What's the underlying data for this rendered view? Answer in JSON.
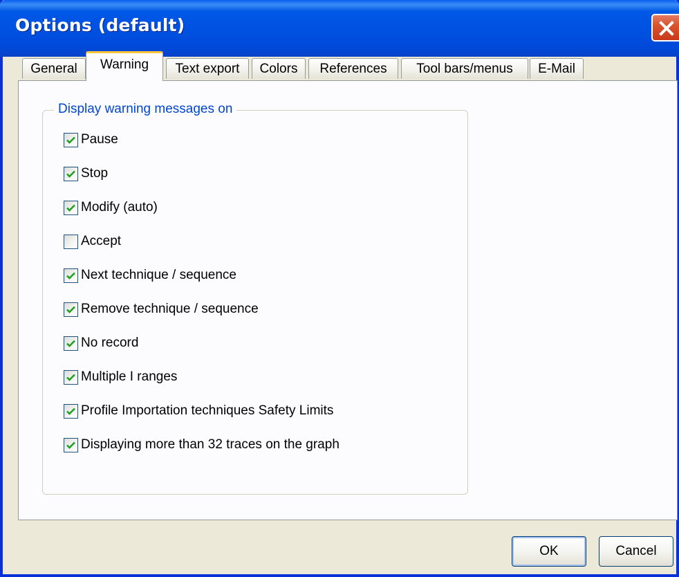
{
  "window": {
    "title": "Options (default)"
  },
  "tabs": [
    {
      "label": "General"
    },
    {
      "label": "Warning",
      "active": true
    },
    {
      "label": "Text export"
    },
    {
      "label": "Colors"
    },
    {
      "label": "References"
    },
    {
      "label": "Tool bars/menus"
    },
    {
      "label": "E-Mail"
    }
  ],
  "group": {
    "title": "Display warning messages on",
    "items": [
      {
        "label": "Pause",
        "checked": true
      },
      {
        "label": "Stop",
        "checked": true
      },
      {
        "label": "Modify (auto)",
        "checked": true
      },
      {
        "label": "Accept",
        "checked": false
      },
      {
        "label": "Next technique / sequence",
        "checked": true
      },
      {
        "label": "Remove technique / sequence",
        "checked": true
      },
      {
        "label": "No record",
        "checked": true
      },
      {
        "label": "Multiple I ranges",
        "checked": true
      },
      {
        "label": "Profile Importation techniques Safety Limits",
        "checked": true
      },
      {
        "label": "Displaying more than 32 traces on the graph",
        "checked": true
      }
    ]
  },
  "buttons": {
    "ok_label": "OK",
    "cancel_label": "Cancel"
  },
  "colors": {
    "titlebar": "#0054E3",
    "accent_tab": "#FFC83C",
    "group_title": "#0046D5",
    "checkmark": "#21A121"
  }
}
